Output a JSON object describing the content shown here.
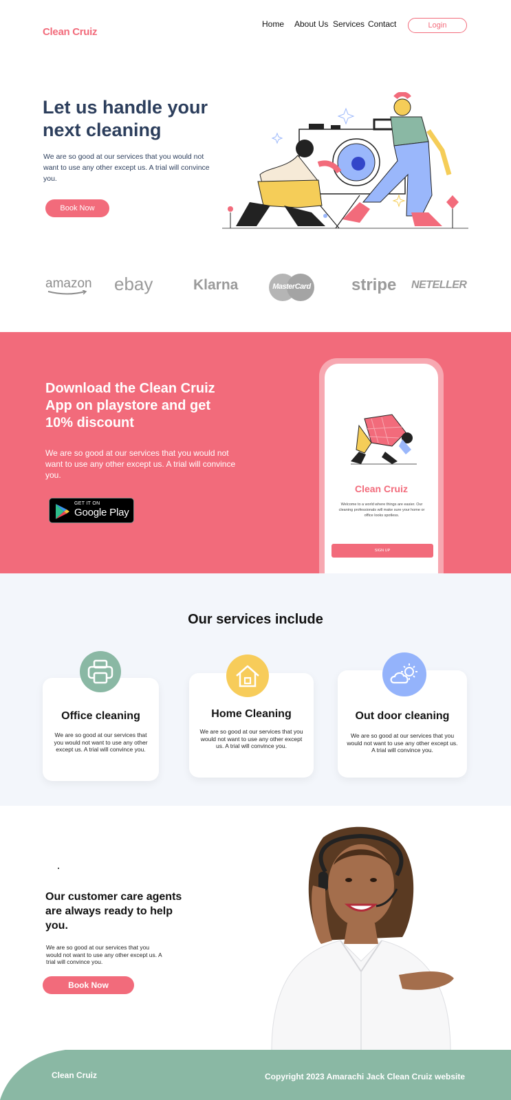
{
  "brand": "Clean Cruiz",
  "nav": {
    "items": [
      "Home",
      "About Us",
      "Services",
      "Contact"
    ],
    "login": "Login"
  },
  "hero": {
    "title": "Let us handle your next cleaning",
    "text": "We are so good at our services that you would not want to use any other except us. A trial will convince you.",
    "cta": "Book Now"
  },
  "partners": [
    "amazon",
    "ebay",
    "Klarna",
    "MasterCard",
    "stripe",
    "NETELLER"
  ],
  "download": {
    "title": "Download the Clean Cruiz App on playstore and get 10% discount",
    "text": "We are so good at our services that you would not want to use any other except us. A trial will convince you.",
    "store_small": "GET IT ON",
    "store_big": "Google Play",
    "phone": {
      "brand": "Clean Cruiz",
      "text": "Welcome to a world where things are easier. Our cleaning professionals will make sure your home or office looks spotless.",
      "signup": "SIGN UP"
    }
  },
  "services": {
    "title": "Our services include",
    "cards": [
      {
        "title": "Office cleaning",
        "text": "We are so good at our services that you would not want to use any other except us. A trial will convince you.",
        "icon": "printer-icon",
        "color": "#8ab8a4"
      },
      {
        "title": "Home Cleaning",
        "text": "We are so good at our services that you would not want to use any other except us. A trial will convince you.",
        "icon": "house-icon",
        "color": "#f7cc5a"
      },
      {
        "title": "Out door cleaning",
        "text": "We are so good at our services that you would not want to use any other except us. A trial will convince you.",
        "icon": "cloud-sun-icon",
        "color": "#94b3fb"
      }
    ]
  },
  "agents": {
    "title": "Our customer care agents are always ready to help you.",
    "text": "We are so good at our services that you would not want to use any other except us. A trial will convince you.",
    "cta": "Book Now"
  },
  "footer": {
    "logo": "Clean Cruiz",
    "copyright": "Copyright 2023 Amarachi Jack Clean Cruiz website"
  },
  "colors": {
    "accent": "#f26b7b",
    "heading": "#2c3e5c",
    "footer": "#8ab8a4",
    "services_bg": "#f3f6fb"
  }
}
